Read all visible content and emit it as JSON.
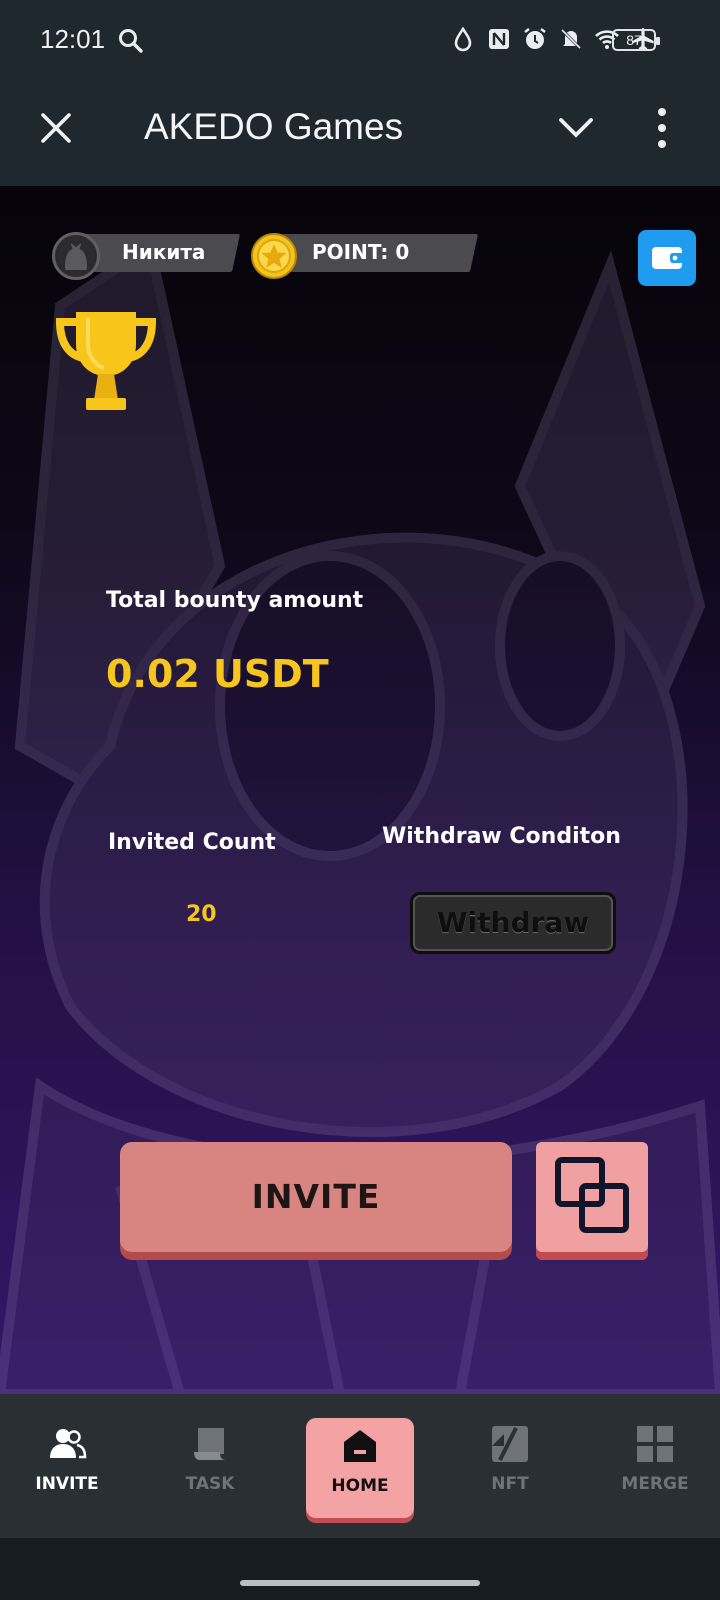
{
  "status_bar": {
    "time": "12:01",
    "battery": "87"
  },
  "app_bar": {
    "title": "AKEDO Games"
  },
  "game": {
    "user_name": "Никита",
    "points_label": "POINT: 0",
    "bounty_label": "Total bounty amount",
    "bounty_value": "0.02 USDT",
    "invited_label": "Invited Count",
    "invited_value": "20",
    "withdraw_condition_label": "Withdraw Conditon",
    "withdraw_button": "Withdraw",
    "invite_button": "INVITE"
  },
  "bottom_nav": [
    {
      "label": "INVITE",
      "icon": "users-icon",
      "active": true
    },
    {
      "label": "TASK",
      "icon": "scroll-icon",
      "active": false
    },
    {
      "label": "HOME",
      "icon": "home-icon",
      "active": false
    },
    {
      "label": "NFT",
      "icon": "nft-icon",
      "active": false
    },
    {
      "label": "MERGE",
      "icon": "grid-icon",
      "active": false
    }
  ],
  "colors": {
    "accent_yellow": "#f6c51e",
    "invite_button": "#d88582",
    "home_tab": "#f3a3a3",
    "wallet_blue": "#1f9bf0"
  }
}
